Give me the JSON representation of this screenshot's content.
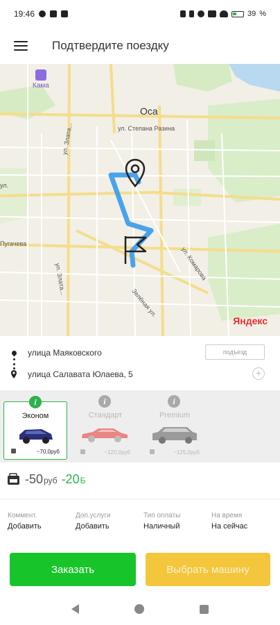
{
  "status_bar": {
    "time": "19:46",
    "battery": "39"
  },
  "app_bar": {
    "title": "Подтвердите поездку"
  },
  "map": {
    "city": "Оса",
    "poi": "Кама",
    "streets": {
      "razina": "ул. Степана Разина",
      "zlatousta": "ул. Злата...",
      "zlatousta2": "ул. Злата...",
      "pugacheva": "Пугачева",
      "komarova": "ул. Комарова",
      "zelenaya": "Зелёная ул.",
      "left_ul": "ул."
    },
    "brand": "Яндекс"
  },
  "route": {
    "from": "улица Маяковского",
    "to": "улица Салавата Юлаева, 5",
    "entrance_label": "подъезд",
    "add_stop": "+"
  },
  "tariffs": [
    {
      "name": "Эконом",
      "price": "~70,0руб",
      "active": true,
      "car_color": "#2b2f7a"
    },
    {
      "name": "Стандарт",
      "price": "~120,0руб",
      "active": false,
      "car_color": "#e98582"
    },
    {
      "name": "Premium",
      "price": "~125,0руб",
      "active": false,
      "car_color": "#9a9a9a"
    }
  ],
  "bonus": {
    "amount": "-50",
    "unit": "руб",
    "green_amount": "-20",
    "green_unit": "Б"
  },
  "options": [
    {
      "label": "Коммент.",
      "value": "Добавить"
    },
    {
      "label": "Доп.услуги",
      "value": "Добавить"
    },
    {
      "label": "Тип оплаты",
      "value": "Наличный"
    },
    {
      "label": "На время",
      "value": "На сейчас"
    }
  ],
  "buttons": {
    "order": "Заказать",
    "choose_car": "Выбрать машину"
  },
  "colors": {
    "accent_green": "#17c52a",
    "accent_yellow": "#f3c63c",
    "route_blue": "#4aa3ea"
  }
}
